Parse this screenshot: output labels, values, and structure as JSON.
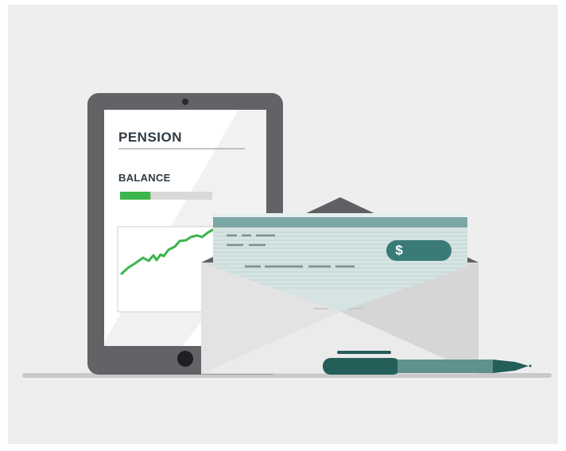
{
  "tablet": {
    "title": "PENSION",
    "balance_label": "BALANCE",
    "balance_progress": 0.33
  },
  "check": {
    "currency_symbol": "$"
  },
  "colors": {
    "background": "#eeeeee",
    "tablet_frame": "#626366",
    "accent_green": "#3cb54a",
    "check_teal": "#7ba7a5",
    "badge_teal": "#3a7b77",
    "pen_dark": "#245e59",
    "envelope": "#dcdcdc"
  },
  "icons": [
    "camera-icon",
    "home-button-icon",
    "pen-icon",
    "envelope-icon",
    "check-icon"
  ]
}
